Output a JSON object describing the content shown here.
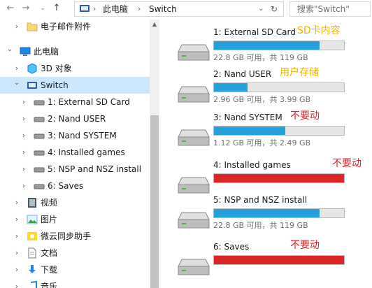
{
  "address": {
    "breadcrumbs": [
      "此电脑",
      "Switch"
    ],
    "search_placeholder": "搜索\"Switch\""
  },
  "tree": [
    {
      "label": "电子邮件附件",
      "icon": "folder-icon",
      "chevron": ">",
      "indent": 1
    },
    {
      "label": "此电脑",
      "icon": "computer-icon",
      "chevron": "v",
      "indent": 0
    },
    {
      "label": "3D 对象",
      "icon": "3d-objects-icon",
      "chevron": ">",
      "indent": 1
    },
    {
      "label": "Switch",
      "icon": "switch-device-icon",
      "chevron": "v",
      "indent": 1,
      "selected": true
    },
    {
      "label": "1: External SD Card",
      "icon": "drive-icon",
      "chevron": ">",
      "indent": 2
    },
    {
      "label": "2: Nand USER",
      "icon": "drive-icon",
      "chevron": ">",
      "indent": 2
    },
    {
      "label": "3: Nand SYSTEM",
      "icon": "drive-icon",
      "chevron": ">",
      "indent": 2
    },
    {
      "label": "4: Installed games",
      "icon": "drive-icon",
      "chevron": ">",
      "indent": 2
    },
    {
      "label": "5: NSP and NSZ install",
      "icon": "drive-icon",
      "chevron": ">",
      "indent": 2
    },
    {
      "label": "6: Saves",
      "icon": "drive-icon",
      "chevron": ">",
      "indent": 2
    },
    {
      "label": "视频",
      "icon": "video-icon",
      "chevron": ">",
      "indent": 1
    },
    {
      "label": "图片",
      "icon": "pictures-icon",
      "chevron": ">",
      "indent": 1
    },
    {
      "label": "微云同步助手",
      "icon": "weiyun-icon",
      "chevron": ">",
      "indent": 1
    },
    {
      "label": "文档",
      "icon": "documents-icon",
      "chevron": ">",
      "indent": 1
    },
    {
      "label": "下载",
      "icon": "downloads-icon",
      "chevron": ">",
      "indent": 1
    },
    {
      "label": "音乐",
      "icon": "music-icon",
      "chevron": ">",
      "indent": 1
    }
  ],
  "drives": [
    {
      "label": "1: External SD Card",
      "annotation": "SD卡内容",
      "annotation_color": "#f2b400",
      "size_text": "22.8 GB 可用，共 119 GB",
      "used_fraction": 0.81,
      "bar_color": "#26a0da"
    },
    {
      "label": "2: Nand USER",
      "annotation": "用户存储",
      "annotation_color": "#f2b400",
      "size_text": "2.96 GB 可用，共 3.99 GB",
      "used_fraction": 0.26,
      "bar_color": "#26a0da"
    },
    {
      "label": "3: Nand SYSTEM",
      "annotation": "不要动",
      "annotation_color": "#e02020",
      "size_text": "1.12 GB 可用，共 2.49 GB",
      "used_fraction": 0.55,
      "bar_color": "#26a0da"
    },
    {
      "label": "4: Installed games",
      "annotation": "不要动",
      "annotation_color": "#e02020",
      "size_text": "",
      "used_fraction": 1.0,
      "bar_color": "#da2626"
    },
    {
      "label": "5: NSP and NSZ install",
      "annotation": "",
      "annotation_color": "#e02020",
      "size_text": "22.8 GB 可用，共 119 GB",
      "used_fraction": 0.81,
      "bar_color": "#26a0da"
    },
    {
      "label": "6: Saves",
      "annotation": "不要动",
      "annotation_color": "#e02020",
      "size_text": "",
      "used_fraction": 1.0,
      "bar_color": "#da2626"
    }
  ]
}
